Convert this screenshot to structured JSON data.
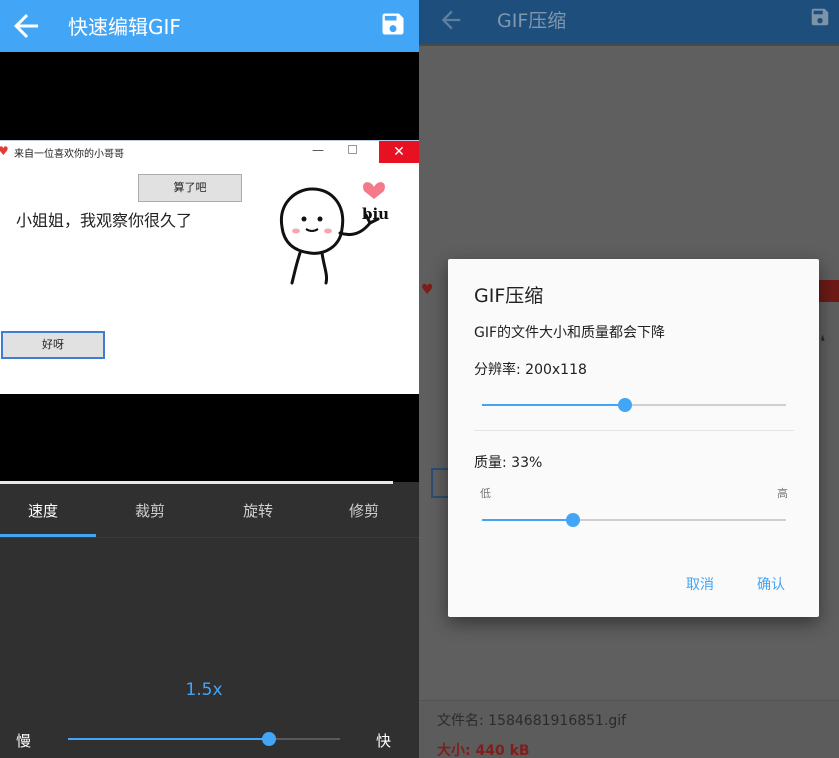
{
  "left": {
    "appbar": {
      "title": "快速编辑GIF",
      "back_icon": "arrow-left-icon",
      "save_icon": "save-icon",
      "color": "#42a5f5"
    },
    "preview": {
      "window_title": "来自一位喜欢你的小哥哥",
      "button_top": "算了吧",
      "text": "小姐姐，我观察你很久了",
      "button_bottom": "好呀",
      "sticker_text": "biu"
    },
    "tabs": [
      {
        "label": "速度",
        "active": true
      },
      {
        "label": "裁剪",
        "active": false
      },
      {
        "label": "旋转",
        "active": false
      },
      {
        "label": "修剪",
        "active": false
      }
    ],
    "speed": {
      "value_label": "1.5x",
      "slow_label": "慢",
      "fast_label": "快",
      "position": 0.74
    }
  },
  "right": {
    "appbar": {
      "title": "GIF压缩",
      "back_icon": "arrow-left-icon",
      "save_icon": "save-icon"
    },
    "dialog": {
      "title": "GIF压缩",
      "message": "GIF的文件大小和质量都会下降",
      "resolution_label": "分辨率: 200x118",
      "resolution_position": 0.47,
      "quality_label": "质量: 33%",
      "quality_position": 0.3,
      "low_label": "低",
      "high_label": "高",
      "cancel_label": "取消",
      "ok_label": "确认"
    },
    "file": {
      "name": "文件名: 1584681916851.gif",
      "size": "大小: 440 kB"
    }
  }
}
